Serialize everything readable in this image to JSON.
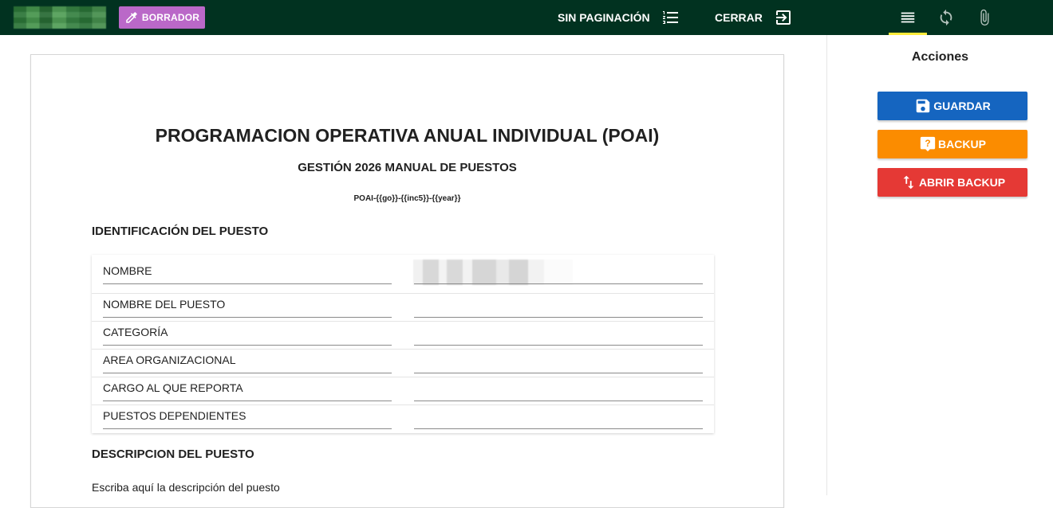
{
  "header": {
    "draft_label": "BORRADOR",
    "no_pagination_label": "SIN PAGINACIÓN",
    "close_label": "CERRAR"
  },
  "tabs": [
    {
      "icon": "list-icon",
      "active": true
    },
    {
      "icon": "sync-icon",
      "active": false
    },
    {
      "icon": "paperclip-icon",
      "active": false
    }
  ],
  "document": {
    "title": "PROGRAMACION OPERATIVA ANUAL INDIVIDUAL (POAI)",
    "subtitle": "GESTIÓN 2026 MANUAL DE PUESTOS",
    "code": "POAI-{{go}}-{{inc5}}-{{year}}",
    "identification": {
      "heading": "IDENTIFICACIÓN DEL PUESTO",
      "fields": [
        {
          "label": "NOMBRE",
          "value": ""
        },
        {
          "label": "NOMBRE DEL PUESTO",
          "value": ""
        },
        {
          "label": "CATEGORÍA",
          "value": ""
        },
        {
          "label": "AREA ORGANIZACIONAL",
          "value": ""
        },
        {
          "label": "CARGO AL QUE REPORTA",
          "value": ""
        },
        {
          "label": "PUESTOS DEPENDIENTES",
          "value": ""
        }
      ]
    },
    "description": {
      "heading": "DESCRIPCION DEL PUESTO",
      "placeholder": "Escriba aquí la descripción del puesto"
    }
  },
  "side_panel": {
    "title": "Acciones",
    "save_label": "GUARDAR",
    "backup_label": "BACKUP",
    "open_backup_label": "ABRIR BACKUP"
  },
  "colors": {
    "topbar": "#013220",
    "draft_badge": "#ba68c8",
    "tab_indicator": "#ffeb3b",
    "save": "#1565c0",
    "backup": "#fb8c00",
    "open_backup": "#e53935"
  }
}
